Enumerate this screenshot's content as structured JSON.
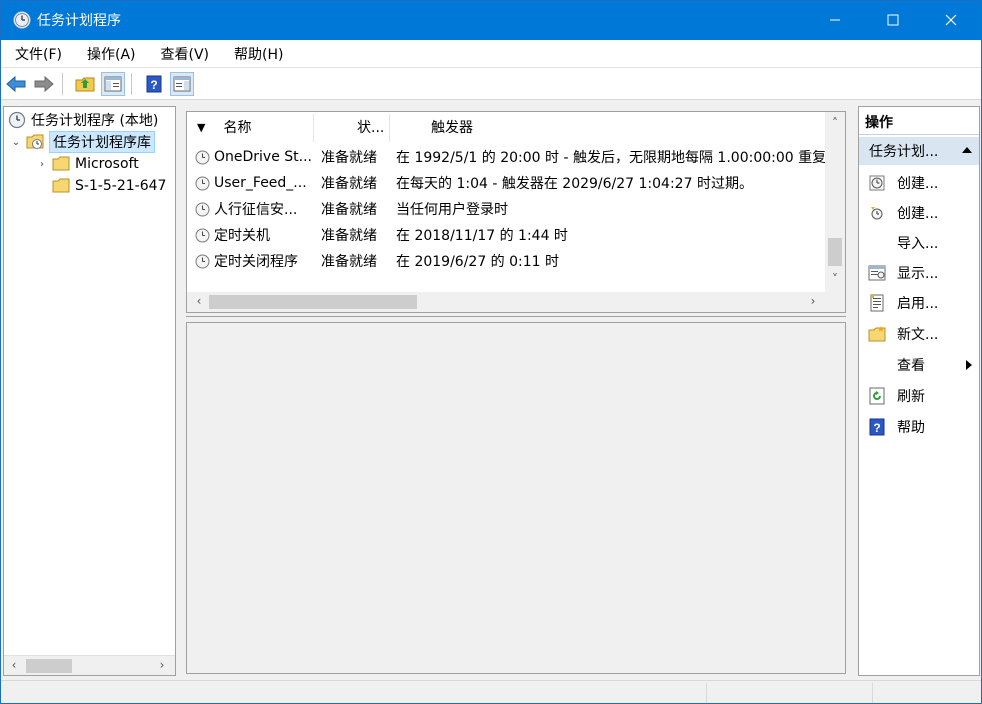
{
  "window": {
    "title": "任务计划程序",
    "accent": "#0078d7",
    "icon": "clock-icon"
  },
  "menu": {
    "items": [
      "文件(F)",
      "操作(A)",
      "查看(V)",
      "帮助(H)"
    ]
  },
  "toolbar": {
    "buttons": [
      "back-arrow-icon",
      "forward-arrow-icon",
      "up-folder-icon",
      "show-hide-tree-icon",
      "help-icon",
      "show-hide-action-pane-icon"
    ]
  },
  "tree": {
    "root": "任务计划程序 (本地)",
    "library": "任务计划程序库",
    "children": [
      "Microsoft",
      "S-1-5-21-647"
    ]
  },
  "tasklist": {
    "columns": [
      "名称",
      "状...",
      "触发器"
    ],
    "rows": [
      {
        "name": "OneDrive St...",
        "status": "准备就绪",
        "trigger": "在 1992/5/1 的 20:00 时 - 触发后，无限期地每隔 1.00:00:00 重复"
      },
      {
        "name": "User_Feed_...",
        "status": "准备就绪",
        "trigger": "在每天的 1:04 - 触发器在 2029/6/27 1:04:27 时过期。"
      },
      {
        "name": "人行征信安...",
        "status": "准备就绪",
        "trigger": "当任何用户登录时"
      },
      {
        "name": "定时关机",
        "status": "准备就绪",
        "trigger": "在 2018/11/17 的 1:44 时"
      },
      {
        "name": "定时关闭程序",
        "status": "准备就绪",
        "trigger": "在 2019/6/27 的 0:11 时"
      }
    ]
  },
  "actions": {
    "header": "操作",
    "section": "任务计划...",
    "items": [
      {
        "label": "创建...",
        "icon": "create-basic-task-icon"
      },
      {
        "label": "创建...",
        "icon": "create-task-icon"
      },
      {
        "label": "导入...",
        "icon": ""
      },
      {
        "label": "显示...",
        "icon": "display-running-tasks-icon"
      },
      {
        "label": "启用...",
        "icon": "enable-history-icon"
      },
      {
        "label": "新文...",
        "icon": "new-folder-icon"
      },
      {
        "label": "查看",
        "icon": ""
      },
      {
        "label": "刷新",
        "icon": "refresh-icon"
      },
      {
        "label": "帮助",
        "icon": "help-icon"
      }
    ]
  }
}
